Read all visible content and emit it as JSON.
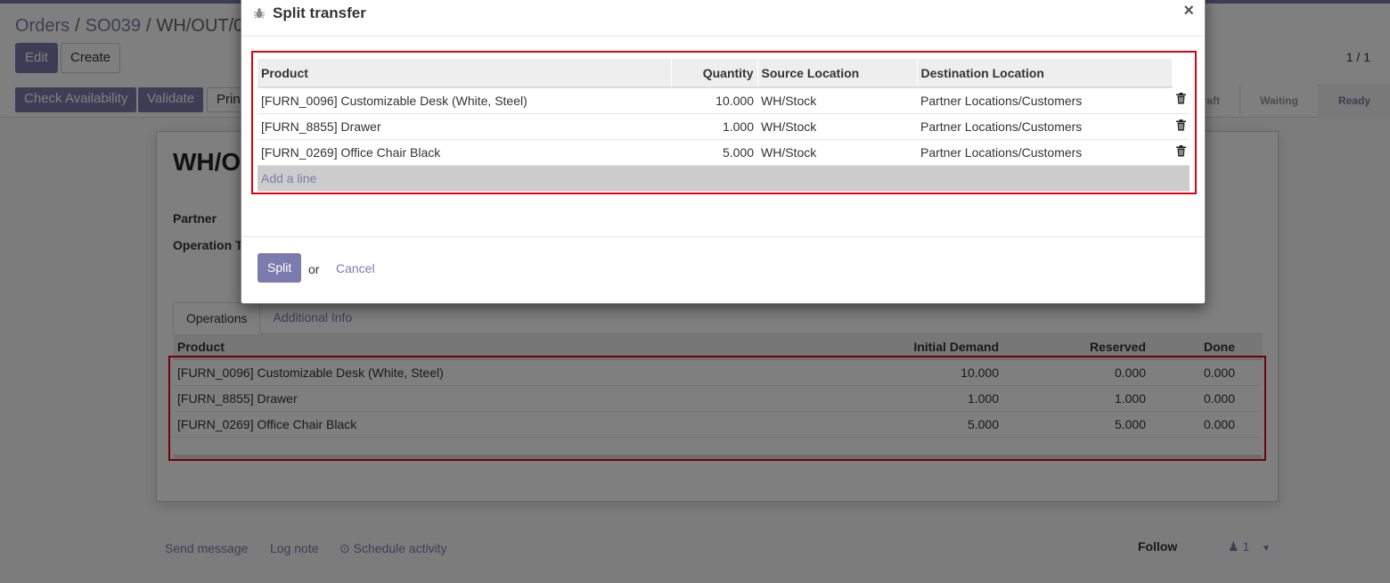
{
  "breadcrumb": {
    "items": [
      "Orders",
      "SO039",
      "WH/OUT/0"
    ],
    "separator": "/"
  },
  "toolbar": {
    "edit": "Edit",
    "create": "Create",
    "pager": "1 / 1"
  },
  "statusbar": {
    "buttons": [
      "Check Availability",
      "Validate",
      "Print"
    ],
    "stages": [
      "Draft",
      "Waiting",
      "Ready"
    ],
    "active_stage": "Ready"
  },
  "sheet": {
    "title": "WH/O",
    "partner_label": "Partner",
    "operation_label": "Operation T",
    "tabs": [
      "Operations",
      "Additional Info"
    ],
    "columns": [
      "Product",
      "Initial Demand",
      "Reserved",
      "Done"
    ],
    "rows": [
      {
        "product": "[FURN_0096] Customizable Desk (White, Steel)",
        "demand": "10.000",
        "reserved": "0.000",
        "done": "0.000"
      },
      {
        "product": "[FURN_8855] Drawer",
        "demand": "1.000",
        "reserved": "1.000",
        "done": "0.000"
      },
      {
        "product": "[FURN_0269] Office Chair Black",
        "demand": "5.000",
        "reserved": "5.000",
        "done": "0.000"
      }
    ]
  },
  "chatter": {
    "send_message": "Send message",
    "log_note": "Log note",
    "schedule": "Schedule activity",
    "follow": "Follow",
    "followers": "1"
  },
  "modal": {
    "title": "Split transfer",
    "close": "×",
    "columns": [
      "Product",
      "Quantity",
      "Source Location",
      "Destination Location"
    ],
    "rows": [
      {
        "product": "[FURN_0096] Customizable Desk (White, Steel)",
        "qty": "10.000",
        "src": "WH/Stock",
        "dst": "Partner Locations/Customers"
      },
      {
        "product": "[FURN_8855] Drawer",
        "qty": "1.000",
        "src": "WH/Stock",
        "dst": "Partner Locations/Customers"
      },
      {
        "product": "[FURN_0269] Office Chair Black",
        "qty": "5.000",
        "src": "WH/Stock",
        "dst": "Partner Locations/Customers"
      }
    ],
    "add_line": "Add a line",
    "split": "Split",
    "or": "or",
    "cancel": "Cancel"
  },
  "colors": {
    "brand": "#7c7bad",
    "highlight": "#e3000f"
  }
}
